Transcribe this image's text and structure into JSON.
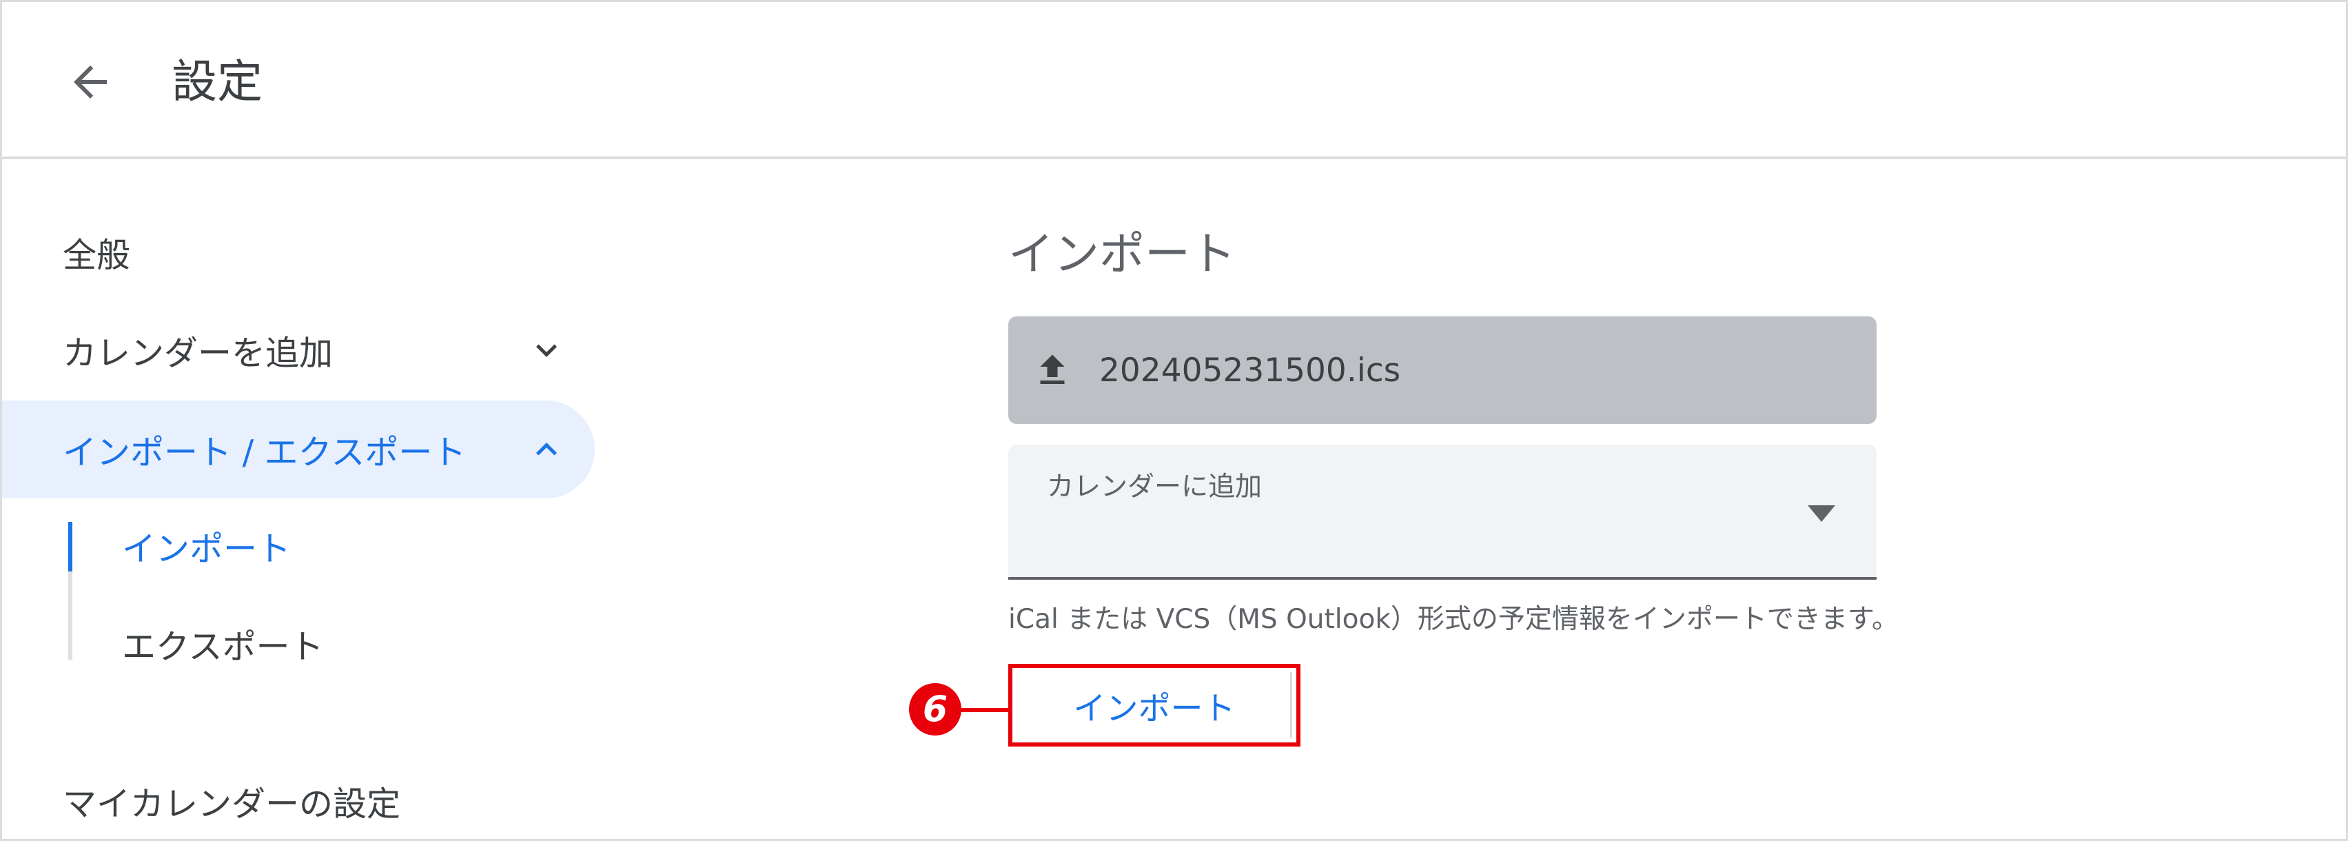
{
  "header": {
    "title": "設定"
  },
  "sidebar": {
    "items": [
      {
        "label": "全般"
      },
      {
        "label": "カレンダーを追加"
      },
      {
        "label": "インポート / エクスポート"
      },
      {
        "label": "マイカレンダーの設定"
      }
    ],
    "subitems": [
      {
        "label": "インポート"
      },
      {
        "label": "エクスポート"
      }
    ]
  },
  "main": {
    "section_title": "インポート",
    "file_name": "202405231500.ics",
    "select_label": "カレンダーに追加",
    "help_text": "iCal または VCS（MS Outlook）形式の予定情報をインポートできます。",
    "import_button_label": "インポート"
  },
  "annotation": {
    "step_number": "6"
  },
  "colors": {
    "accent": "#1a73e8",
    "active_bg": "#e8f0fe",
    "highlight": "#e8000b",
    "file_box_bg": "#bdc1c6",
    "select_bg": "#f1f3f4"
  }
}
